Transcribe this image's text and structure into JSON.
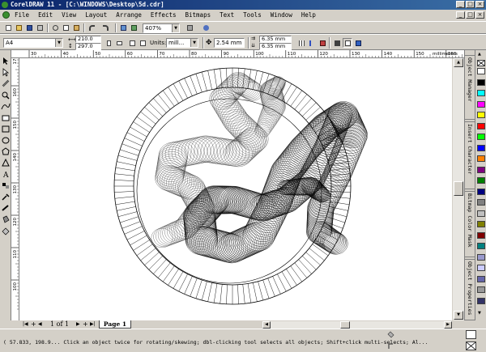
{
  "window": {
    "title": "CorelDRAW 11 - [C:\\WINDOWS\\Desktop\\5d.cdr]",
    "minimize": "_",
    "maximize": "□",
    "close": "×"
  },
  "menu": {
    "items": [
      "File",
      "Edit",
      "View",
      "Layout",
      "Arrange",
      "Effects",
      "Bitmaps",
      "Text",
      "Tools",
      "Window",
      "Help"
    ]
  },
  "standard_toolbar": {
    "zoom_level": "407%"
  },
  "property_bar": {
    "paper_size": "A4",
    "width": "210.0",
    "height": "297.0",
    "units_label": "Units:",
    "units_value": "mill...",
    "nudge": "2.54 mm",
    "dup_x": "6.35 mm",
    "dup_y": "6.35 mm"
  },
  "rulers": {
    "h_ticks": [
      "30",
      "40",
      "50",
      "60",
      "70",
      "80",
      "90",
      "100",
      "110",
      "120",
      "130",
      "140",
      "150",
      "160"
    ],
    "unit": "millimeters",
    "v_ticks": [
      "170",
      "160",
      "150",
      "140",
      "130",
      "120",
      "110",
      "100"
    ]
  },
  "dockers": {
    "tabs": [
      "Object Manager",
      "Insert Character",
      "Bitmap Color Mask",
      "Object Properties"
    ]
  },
  "palette": {
    "colors": [
      "#ffffff",
      "#000000",
      "#00ffff",
      "#ff00ff",
      "#ffff00",
      "#ff0000",
      "#00ff00",
      "#0000ff",
      "#ff8000",
      "#800080",
      "#008000",
      "#000080",
      "#808080",
      "#c0c0c0",
      "#808000",
      "#800000",
      "#008080",
      "#9999cc",
      "#ccccff",
      "#6666aa",
      "#999999",
      "#333366"
    ]
  },
  "page_nav": {
    "counter": "1 of 1",
    "page_tab": "Page 1"
  },
  "status": {
    "text": "( 57.833, 198.9... Click an object twice for rotating/skewing; dbl-clicking tool selects all objects; Shift+click multi-selects; Al..."
  }
}
